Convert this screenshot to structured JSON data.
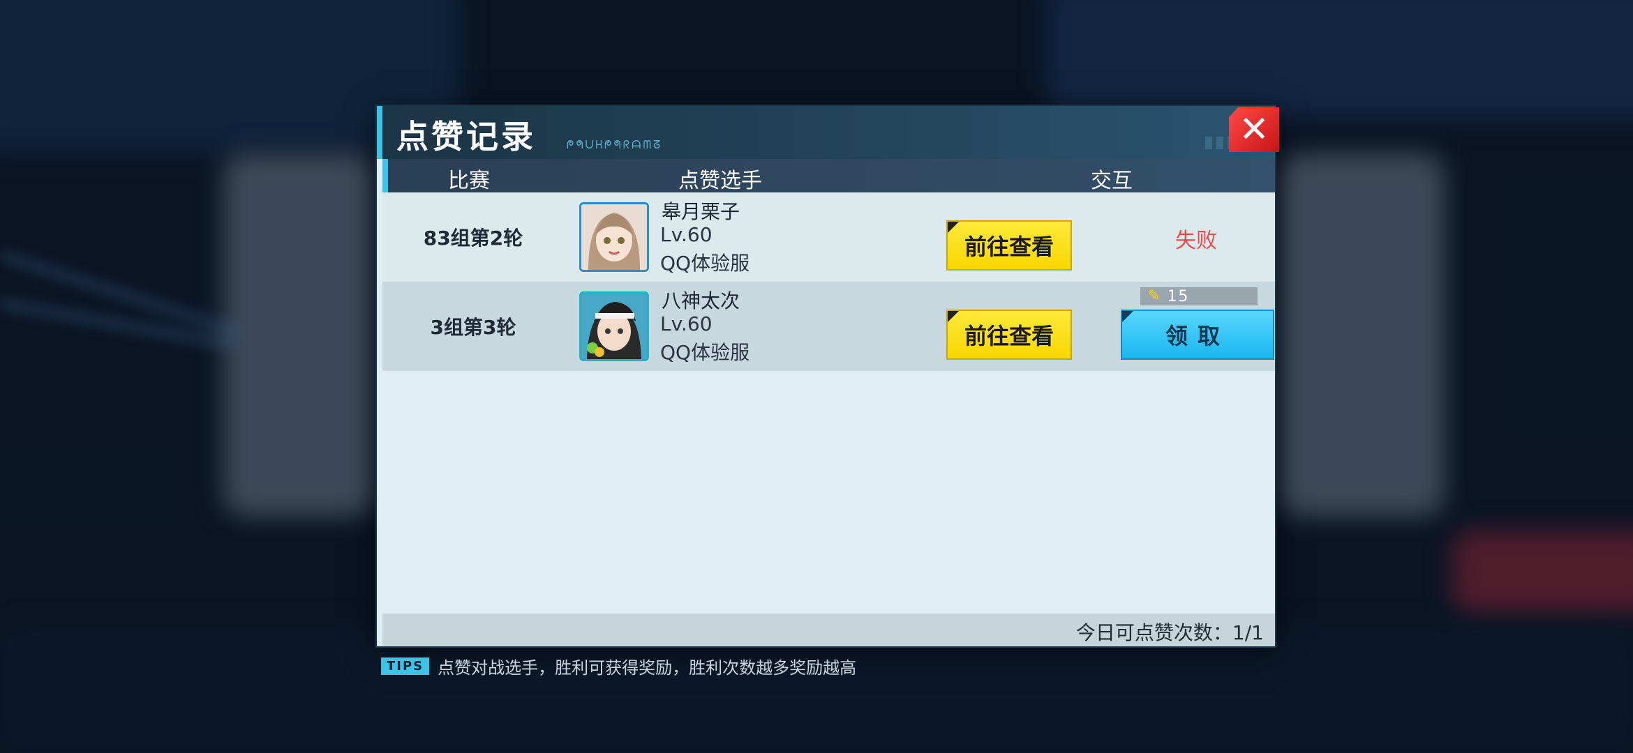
{
  "dialog": {
    "title": "点赞记录",
    "title_code": "ᖘᖗᑌᕼᖘᖗᖇᗩᗰᘔ",
    "close_icon": "close-icon"
  },
  "columns": {
    "match": "比赛",
    "player": "点赞选手",
    "interact": "交互"
  },
  "rows": [
    {
      "match": "83组第2轮",
      "player_name": "皋月栗子",
      "level": "Lv.60",
      "server": "QQ体验服",
      "goto_label": "前往查看",
      "result": "失败"
    },
    {
      "match": "3组第3轮",
      "player_name": "八神太次",
      "level": "Lv.60",
      "server": "QQ体验服",
      "goto_label": "前往查看",
      "reward_icon": "pencil-icon",
      "reward_value": "15",
      "claim_label": "领取"
    }
  ],
  "footer": {
    "quota_label": "今日可点赞次数：1/1"
  },
  "tips": {
    "badge": "TIPS",
    "text": "点赞对战选手，胜利可获得奖励，胜利次数越多奖励越高"
  },
  "colors": {
    "accent": "#3cc4e8",
    "goto_button": "#f8d800",
    "claim_button": "#1ab6ee",
    "fail_text": "#ef4a4a",
    "close_button": "#e02020"
  }
}
